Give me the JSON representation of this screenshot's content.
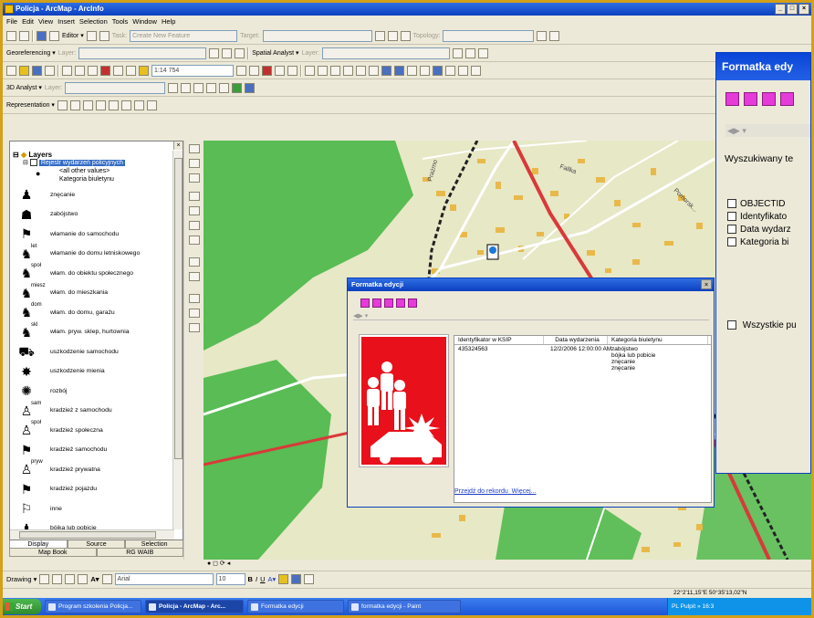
{
  "window": {
    "title": "Policja - ArcMap - ArcInfo",
    "controls": [
      "_",
      "□",
      "×"
    ]
  },
  "menu": [
    "File",
    "Edit",
    "View",
    "Insert",
    "Selection",
    "Tools",
    "Window",
    "Help"
  ],
  "editor_toolbar": {
    "editor_label": "Editor ▾",
    "task_label": "Task:",
    "task_value": "Create New Feature",
    "target_label": "Target:",
    "topology_label": "Topology:"
  },
  "georef_toolbar": {
    "georef_label": "Georeferencing ▾",
    "layer_label": "Layer:",
    "spatial_label": "Spatial Analyst ▾",
    "layer2_label": "Layer:"
  },
  "standard_toolbar": {
    "scale": "1:14 754"
  },
  "analyst_toolbar": {
    "label": "3D Analyst ▾",
    "layer_label": "Layer:"
  },
  "representation_toolbar": {
    "label": "Representation ▾"
  },
  "toc": {
    "close": "×",
    "root": "Layers",
    "layer_name": "Rejestr wydarzeń policyjnych",
    "sub1": "<all other values>",
    "sub2": "Kategoria biuletynu",
    "legend": [
      {
        "icon": "♟",
        "sup": "",
        "label": "znęcanie"
      },
      {
        "icon": "☗",
        "sup": "",
        "label": "zabójstwo"
      },
      {
        "icon": "⚑",
        "sup": "",
        "label": "włamanie do samochodu"
      },
      {
        "icon": "♞",
        "sup": "let",
        "label": "włamanie do domu letniskowego"
      },
      {
        "icon": "♞",
        "sup": "społ",
        "label": "włam. do obiektu społecznego"
      },
      {
        "icon": "♞",
        "sup": "miesz",
        "label": "włam. do mieszkania"
      },
      {
        "icon": "♞",
        "sup": "dom",
        "label": "włam. do domu, garażu"
      },
      {
        "icon": "♞",
        "sup": "skl",
        "label": "włam. pryw. sklep, hurtownia"
      },
      {
        "icon": "⛟",
        "sup": "",
        "label": "uszkodzenie samochodu"
      },
      {
        "icon": "✸",
        "sup": "",
        "label": "uszkodzenie mienia"
      },
      {
        "icon": "✺",
        "sup": "",
        "label": "rozbój"
      },
      {
        "icon": "♙",
        "sup": "sam",
        "label": "kradzież z samochodu"
      },
      {
        "icon": "♙",
        "sup": "społ",
        "label": "kradzież społeczna"
      },
      {
        "icon": "⚑",
        "sup": "",
        "label": "kradzież samochodu"
      },
      {
        "icon": "♙",
        "sup": "pryw",
        "label": "kradzież prywatna"
      },
      {
        "icon": "⚑",
        "sup": "",
        "label": "kradzież pojazdu"
      },
      {
        "icon": "⚐",
        "sup": "",
        "label": "inne"
      },
      {
        "icon": "♟",
        "sup": "",
        "label": "bójka lub pobicie"
      }
    ],
    "tabs_top": [
      "Display",
      "Source",
      "Selection"
    ],
    "tabs_bottom": [
      "Map Book",
      "RG WAIB"
    ]
  },
  "map": {
    "street_labels": [
      "Fallka",
      "Prażmo",
      "Pomorsk..."
    ],
    "accent_road": "#d83a3a",
    "colors": {
      "land": "#e7e8c6",
      "green": "#3fb43f",
      "buildings": "#e8b94a"
    }
  },
  "dialog_big": {
    "title": "Formatka edy",
    "search_label": "Wyszukiwany te",
    "fields": [
      "OBJECTID",
      "Identyfikato",
      "Data wydarz",
      "Kategoria bi"
    ],
    "all_label": "Wszystkie pu"
  },
  "dialog": {
    "title": "Formatka edycji",
    "close": "×",
    "columns": [
      "Identyfikator w KSIP",
      "Data wydarzenia",
      "Kategoria biuletynu"
    ],
    "id": "435324563",
    "date": "12/2/2006 12:00:00 AM",
    "categories": [
      "zabójstwo",
      "bójka lub pobicie",
      "znęcanie",
      "znęcanie"
    ],
    "link1": "Przejdź do rekordu",
    "link2": "Więcej..."
  },
  "drawing_toolbar": {
    "label": "Drawing ▾",
    "font": "Arial",
    "size": "10",
    "bold": "B",
    "italic": "I",
    "underline": "U"
  },
  "status": {
    "coords": "22°2'11,15\"E 50°35'13,02\"N"
  },
  "taskbar": {
    "start": "Start",
    "tasks": [
      "Program szkolenia Policja...",
      "Policja - ArcMap - Arc...",
      "Formatka edycji",
      "formatka edycji - Paint"
    ],
    "tray": "PL  Pulpit  »  16:3"
  }
}
